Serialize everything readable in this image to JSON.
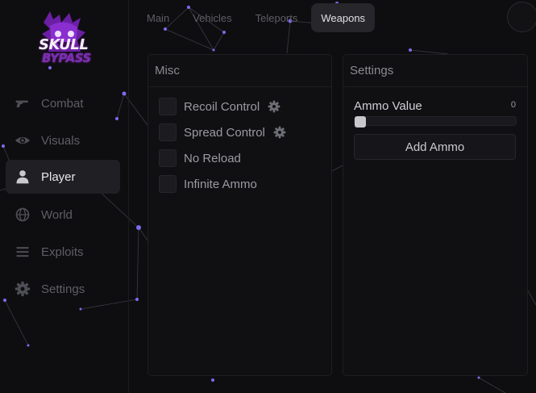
{
  "brand": {
    "logo_line1": "SKULL",
    "logo_line2": "BYPASS",
    "accent_color": "#7b5cff",
    "logo_color": "#8f2fd1"
  },
  "sidebar": {
    "items": [
      {
        "label": "Combat",
        "icon": "gun-icon",
        "active": false
      },
      {
        "label": "Visuals",
        "icon": "eye-icon",
        "active": false
      },
      {
        "label": "Player",
        "icon": "user-icon",
        "active": true
      },
      {
        "label": "World",
        "icon": "globe-icon",
        "active": false
      },
      {
        "label": "Exploits",
        "icon": "menu-lines-icon",
        "active": false
      },
      {
        "label": "Settings",
        "icon": "gear-icon",
        "active": false
      }
    ]
  },
  "tabs": [
    {
      "label": "Main",
      "active": false
    },
    {
      "label": "Vehicles",
      "active": false
    },
    {
      "label": "Teleports",
      "active": false
    },
    {
      "label": "Weapons",
      "active": true
    }
  ],
  "misc_panel": {
    "title": "Misc",
    "options": [
      {
        "label": "Recoil Control",
        "checked": false,
        "has_settings": true
      },
      {
        "label": "Spread Control",
        "checked": false,
        "has_settings": true
      },
      {
        "label": "No Reload",
        "checked": false,
        "has_settings": false
      },
      {
        "label": "Infinite Ammo",
        "checked": false,
        "has_settings": false
      }
    ]
  },
  "settings_panel": {
    "title": "Settings",
    "ammo_label": "Ammo Value",
    "ammo_value": "0",
    "slider_fraction": 0,
    "add_button": "Add Ammo"
  }
}
